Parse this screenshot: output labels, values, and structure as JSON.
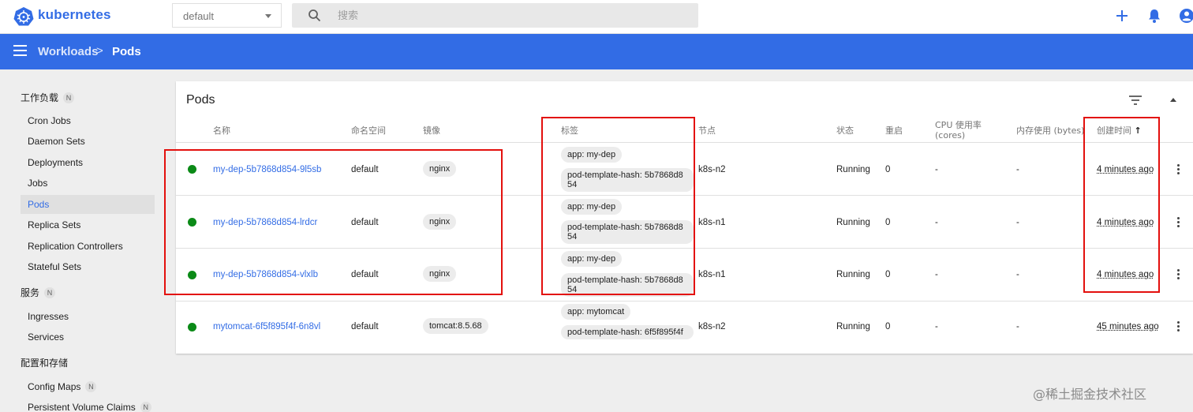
{
  "app": {
    "brand": "kubernetes"
  },
  "topbar": {
    "namespace": "default",
    "search_placeholder": "搜索",
    "icons": [
      "add-icon",
      "notifications-icon",
      "account-icon"
    ]
  },
  "header": {
    "breadcrumb_parent": "Workloads",
    "breadcrumb_separator": ">",
    "breadcrumb_current": "Pods"
  },
  "sidebar": {
    "sections": [
      {
        "title": "工作负载",
        "badge": "N"
      },
      {
        "title": "服务",
        "badge": "N"
      },
      {
        "title": "配置和存储"
      }
    ],
    "workloads": [
      "Cron Jobs",
      "Daemon Sets",
      "Deployments",
      "Jobs",
      "Pods",
      "Replica Sets",
      "Replication Controllers",
      "Stateful Sets"
    ],
    "services": [
      "Ingresses",
      "Services"
    ],
    "config": [
      "Config Maps",
      "Persistent Volume Claims"
    ],
    "config_badges": [
      "N",
      "N"
    ],
    "active": "Pods"
  },
  "card": {
    "title": "Pods",
    "columns": [
      "名称",
      "命名空间",
      "镜像",
      "标签",
      "节点",
      "状态",
      "重启",
      "CPU 使用率",
      "(cores)",
      "内存使用 (bytes)",
      "创建时间",
      "↑"
    ],
    "rows": [
      {
        "name": "my-dep-5b7868d854-9l5sb",
        "namespace": "default",
        "image": "nginx",
        "label1": "app: my-dep",
        "label2": "pod-template-hash: 5b7868d854",
        "node": "k8s-n2",
        "status": "Running",
        "restarts": "0",
        "cpu": "-",
        "mem": "-",
        "age": "4 minutes ago"
      },
      {
        "name": "my-dep-5b7868d854-lrdcr",
        "namespace": "default",
        "image": "nginx",
        "label1": "app: my-dep",
        "label2": "pod-template-hash: 5b7868d854",
        "node": "k8s-n1",
        "status": "Running",
        "restarts": "0",
        "cpu": "-",
        "mem": "-",
        "age": "4 minutes ago"
      },
      {
        "name": "my-dep-5b7868d854-vlxlb",
        "namespace": "default",
        "image": "nginx",
        "label1": "app: my-dep",
        "label2": "pod-template-hash: 5b7868d854",
        "node": "k8s-n1",
        "status": "Running",
        "restarts": "0",
        "cpu": "-",
        "mem": "-",
        "age": "4 minutes ago"
      },
      {
        "name": "mytomcat-6f5f895f4f-6n8vl",
        "namespace": "default",
        "image": "tomcat:8.5.68",
        "label1": "app: mytomcat",
        "label2": "pod-template-hash: 6f5f895f4f",
        "node": "k8s-n2",
        "status": "Running",
        "restarts": "0",
        "cpu": "-",
        "mem": "-",
        "age": "45 minutes ago"
      }
    ]
  },
  "colors": {
    "brand": "#326ce5",
    "running": "#0b8a17",
    "highlight": "#e3100d"
  },
  "watermark": "@稀土掘金技术社区"
}
